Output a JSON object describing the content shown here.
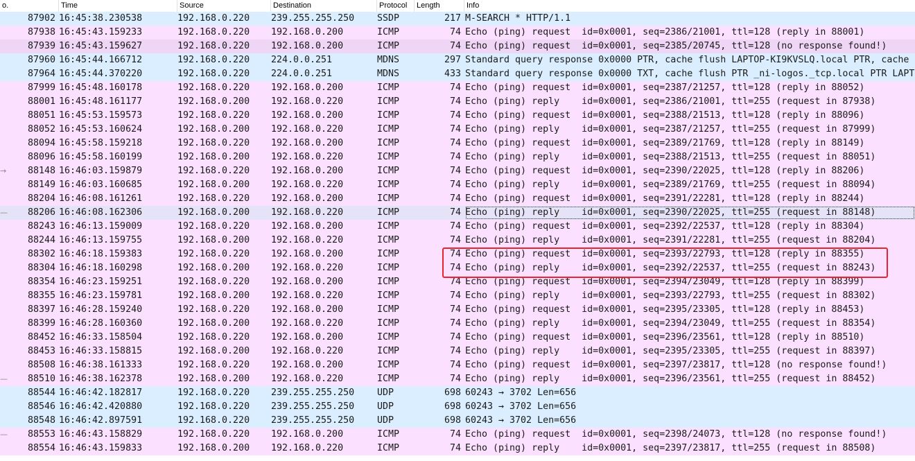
{
  "columns": {
    "no": "o.",
    "time": "Time",
    "source": "Source",
    "destination": "Destination",
    "protocol": "Protocol",
    "length": "Length",
    "info": "Info"
  },
  "colors": {
    "icmp_row": "#fce0ff",
    "udp_row": "#daeeff",
    "selected_row": "#e5e3f7",
    "highlight_box": "#e8242d"
  },
  "rows": [
    {
      "no": "87902",
      "time": "16:45:38.230538",
      "src": "192.168.0.220",
      "dst": "239.255.255.250",
      "proto": "SSDP",
      "len": "217",
      "info": "M-SEARCH * HTTP/1.1",
      "kind": "udp",
      "marker": ""
    },
    {
      "no": "87938",
      "time": "16:45:43.159233",
      "src": "192.168.0.220",
      "dst": "192.168.0.200",
      "proto": "ICMP",
      "len": "74",
      "info": "Echo (ping) request  id=0x0001, seq=2386/21001, ttl=128 (reply in 88001)",
      "kind": "icmp",
      "marker": ""
    },
    {
      "no": "87939",
      "time": "16:45:43.159627",
      "src": "192.168.0.220",
      "dst": "192.168.0.200",
      "proto": "ICMP",
      "len": "74",
      "info": "Echo (ping) request  id=0x0001, seq=2385/20745, ttl=128 (no response found!)",
      "kind": "icmp-dark",
      "marker": ""
    },
    {
      "no": "87960",
      "time": "16:45:44.166712",
      "src": "192.168.0.220",
      "dst": "224.0.0.251",
      "proto": "MDNS",
      "len": "297",
      "info": "Standard query response 0x0000 PTR, cache flush LAPTOP-KI9KVSLQ.local PTR, cache",
      "kind": "udp",
      "marker": ""
    },
    {
      "no": "87964",
      "time": "16:45:44.370220",
      "src": "192.168.0.220",
      "dst": "224.0.0.251",
      "proto": "MDNS",
      "len": "433",
      "info": "Standard query response 0x0000 TXT, cache flush PTR _ni-logos._tcp.local PTR LAPT",
      "kind": "udp",
      "marker": ""
    },
    {
      "no": "87999",
      "time": "16:45:48.160178",
      "src": "192.168.0.220",
      "dst": "192.168.0.200",
      "proto": "ICMP",
      "len": "74",
      "info": "Echo (ping) request  id=0x0001, seq=2387/21257, ttl=128 (reply in 88052)",
      "kind": "icmp",
      "marker": ""
    },
    {
      "no": "88001",
      "time": "16:45:48.161177",
      "src": "192.168.0.200",
      "dst": "192.168.0.220",
      "proto": "ICMP",
      "len": "74",
      "info": "Echo (ping) reply    id=0x0001, seq=2386/21001, ttl=255 (request in 87938)",
      "kind": "icmp",
      "marker": ""
    },
    {
      "no": "88051",
      "time": "16:45:53.159573",
      "src": "192.168.0.220",
      "dst": "192.168.0.200",
      "proto": "ICMP",
      "len": "74",
      "info": "Echo (ping) request  id=0x0001, seq=2388/21513, ttl=128 (reply in 88096)",
      "kind": "icmp",
      "marker": ""
    },
    {
      "no": "88052",
      "time": "16:45:53.160624",
      "src": "192.168.0.200",
      "dst": "192.168.0.220",
      "proto": "ICMP",
      "len": "74",
      "info": "Echo (ping) reply    id=0x0001, seq=2387/21257, ttl=255 (request in 87999)",
      "kind": "icmp",
      "marker": ""
    },
    {
      "no": "88094",
      "time": "16:45:58.159218",
      "src": "192.168.0.220",
      "dst": "192.168.0.200",
      "proto": "ICMP",
      "len": "74",
      "info": "Echo (ping) request  id=0x0001, seq=2389/21769, ttl=128 (reply in 88149)",
      "kind": "icmp",
      "marker": ""
    },
    {
      "no": "88096",
      "time": "16:45:58.160199",
      "src": "192.168.0.200",
      "dst": "192.168.0.220",
      "proto": "ICMP",
      "len": "74",
      "info": "Echo (ping) reply    id=0x0001, seq=2388/21513, ttl=255 (request in 88051)",
      "kind": "icmp",
      "marker": ""
    },
    {
      "no": "88148",
      "time": "16:46:03.159879",
      "src": "192.168.0.220",
      "dst": "192.168.0.200",
      "proto": "ICMP",
      "len": "74",
      "info": "Echo (ping) request  id=0x0001, seq=2390/22025, ttl=128 (reply in 88206)",
      "kind": "icmp",
      "marker": "→"
    },
    {
      "no": "88149",
      "time": "16:46:03.160685",
      "src": "192.168.0.200",
      "dst": "192.168.0.220",
      "proto": "ICMP",
      "len": "74",
      "info": "Echo (ping) reply    id=0x0001, seq=2389/21769, ttl=255 (request in 88094)",
      "kind": "icmp",
      "marker": ""
    },
    {
      "no": "88204",
      "time": "16:46:08.161261",
      "src": "192.168.0.220",
      "dst": "192.168.0.200",
      "proto": "ICMP",
      "len": "74",
      "info": "Echo (ping) request  id=0x0001, seq=2391/22281, ttl=128 (reply in 88244)",
      "kind": "icmp",
      "marker": ""
    },
    {
      "no": "88206",
      "time": "16:46:08.162306",
      "src": "192.168.0.200",
      "dst": "192.168.0.220",
      "proto": "ICMP",
      "len": "74",
      "info": "Echo (ping) reply    id=0x0001, seq=2390/22025, ttl=255 (request in 88148)",
      "kind": "selected",
      "marker": "—"
    },
    {
      "no": "88243",
      "time": "16:46:13.159009",
      "src": "192.168.0.220",
      "dst": "192.168.0.200",
      "proto": "ICMP",
      "len": "74",
      "info": "Echo (ping) request  id=0x0001, seq=2392/22537, ttl=128 (reply in 88304)",
      "kind": "icmp",
      "marker": ""
    },
    {
      "no": "88244",
      "time": "16:46:13.159755",
      "src": "192.168.0.200",
      "dst": "192.168.0.220",
      "proto": "ICMP",
      "len": "74",
      "info": "Echo (ping) reply    id=0x0001, seq=2391/22281, ttl=255 (request in 88204)",
      "kind": "icmp",
      "marker": ""
    },
    {
      "no": "88302",
      "time": "16:46:18.159383",
      "src": "192.168.0.220",
      "dst": "192.168.0.200",
      "proto": "ICMP",
      "len": "74",
      "info": "Echo (ping) request  id=0x0001, seq=2393/22793, ttl=128 (reply in 88355)",
      "kind": "icmp",
      "marker": ""
    },
    {
      "no": "88304",
      "time": "16:46:18.160298",
      "src": "192.168.0.200",
      "dst": "192.168.0.220",
      "proto": "ICMP",
      "len": "74",
      "info": "Echo (ping) reply    id=0x0001, seq=2392/22537, ttl=255 (request in 88243)",
      "kind": "icmp",
      "marker": ""
    },
    {
      "no": "88354",
      "time": "16:46:23.159251",
      "src": "192.168.0.220",
      "dst": "192.168.0.200",
      "proto": "ICMP",
      "len": "74",
      "info": "Echo (ping) request  id=0x0001, seq=2394/23049, ttl=128 (reply in 88399)",
      "kind": "icmp",
      "marker": ""
    },
    {
      "no": "88355",
      "time": "16:46:23.159781",
      "src": "192.168.0.200",
      "dst": "192.168.0.220",
      "proto": "ICMP",
      "len": "74",
      "info": "Echo (ping) reply    id=0x0001, seq=2393/22793, ttl=255 (request in 88302)",
      "kind": "icmp",
      "marker": ""
    },
    {
      "no": "88397",
      "time": "16:46:28.159240",
      "src": "192.168.0.220",
      "dst": "192.168.0.200",
      "proto": "ICMP",
      "len": "74",
      "info": "Echo (ping) request  id=0x0001, seq=2395/23305, ttl=128 (reply in 88453)",
      "kind": "icmp",
      "marker": ""
    },
    {
      "no": "88399",
      "time": "16:46:28.160360",
      "src": "192.168.0.200",
      "dst": "192.168.0.220",
      "proto": "ICMP",
      "len": "74",
      "info": "Echo (ping) reply    id=0x0001, seq=2394/23049, ttl=255 (request in 88354)",
      "kind": "icmp",
      "marker": ""
    },
    {
      "no": "88452",
      "time": "16:46:33.158504",
      "src": "192.168.0.220",
      "dst": "192.168.0.200",
      "proto": "ICMP",
      "len": "74",
      "info": "Echo (ping) request  id=0x0001, seq=2396/23561, ttl=128 (reply in 88510)",
      "kind": "icmp",
      "marker": ""
    },
    {
      "no": "88453",
      "time": "16:46:33.158815",
      "src": "192.168.0.200",
      "dst": "192.168.0.220",
      "proto": "ICMP",
      "len": "74",
      "info": "Echo (ping) reply    id=0x0001, seq=2395/23305, ttl=255 (request in 88397)",
      "kind": "icmp",
      "marker": ""
    },
    {
      "no": "88508",
      "time": "16:46:38.161333",
      "src": "192.168.0.220",
      "dst": "192.168.0.200",
      "proto": "ICMP",
      "len": "74",
      "info": "Echo (ping) request  id=0x0001, seq=2397/23817, ttl=128 (no response found!)",
      "kind": "icmp",
      "marker": ""
    },
    {
      "no": "88510",
      "time": "16:46:38.162378",
      "src": "192.168.0.200",
      "dst": "192.168.0.220",
      "proto": "ICMP",
      "len": "74",
      "info": "Echo (ping) reply    id=0x0001, seq=2396/23561, ttl=255 (request in 88452)",
      "kind": "icmp",
      "marker": "—"
    },
    {
      "no": "88544",
      "time": "16:46:42.182817",
      "src": "192.168.0.220",
      "dst": "239.255.255.250",
      "proto": "UDP",
      "len": "698",
      "info": "60243 → 3702 Len=656",
      "kind": "udp",
      "marker": ""
    },
    {
      "no": "88546",
      "time": "16:46:42.420880",
      "src": "192.168.0.220",
      "dst": "239.255.255.250",
      "proto": "UDP",
      "len": "698",
      "info": "60243 → 3702 Len=656",
      "kind": "udp",
      "marker": ""
    },
    {
      "no": "88548",
      "time": "16:46:42.897591",
      "src": "192.168.0.220",
      "dst": "239.255.255.250",
      "proto": "UDP",
      "len": "698",
      "info": "60243 → 3702 Len=656",
      "kind": "udp",
      "marker": ""
    },
    {
      "no": "88553",
      "time": "16:46:43.158829",
      "src": "192.168.0.220",
      "dst": "192.168.0.200",
      "proto": "ICMP",
      "len": "74",
      "info": "Echo (ping) request  id=0x0001, seq=2398/24073, ttl=128 (no response found!)",
      "kind": "icmp",
      "marker": "—"
    },
    {
      "no": "88554",
      "time": "16:46:43.159833",
      "src": "192.168.0.200",
      "dst": "192.168.0.220",
      "proto": "ICMP",
      "len": "74",
      "info": "Echo (ping) reply    id=0x0001, seq=2397/23817, ttl=255 (request in 88508)",
      "kind": "icmp",
      "marker": ""
    }
  ]
}
